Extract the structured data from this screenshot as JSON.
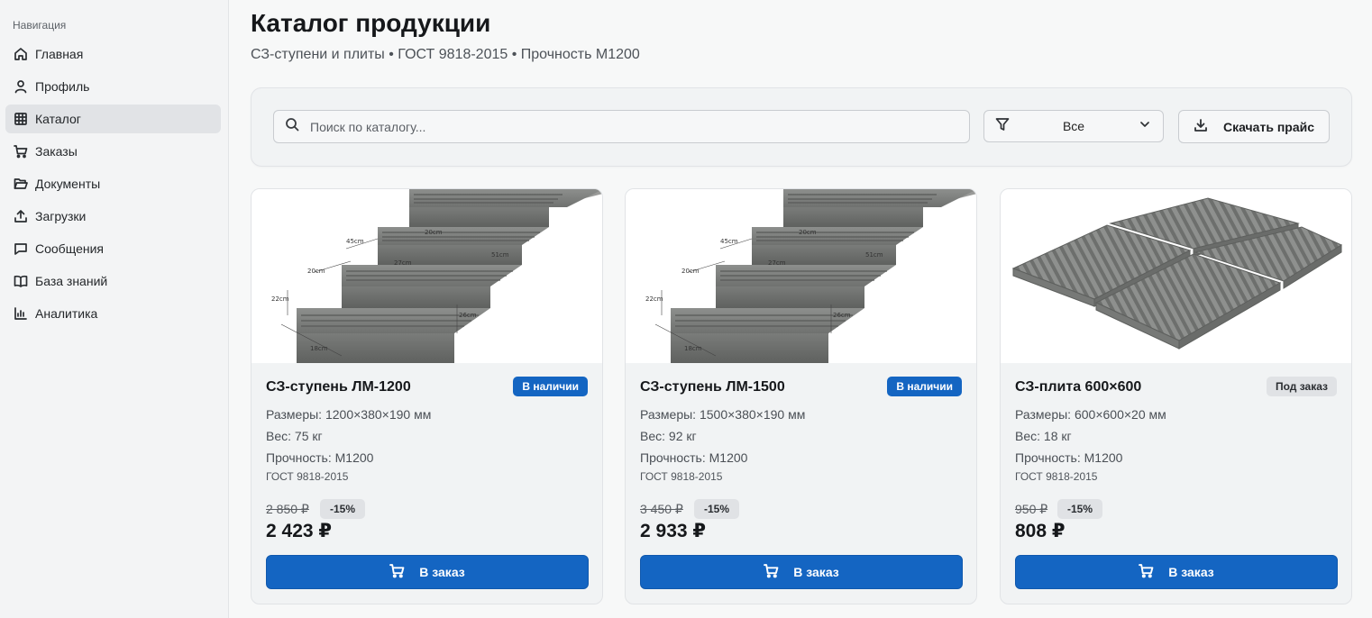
{
  "sidebar": {
    "heading": "Навигация",
    "items": [
      {
        "label": "Главная",
        "icon": "home-icon"
      },
      {
        "label": "Профиль",
        "icon": "user-icon"
      },
      {
        "label": "Каталог",
        "icon": "grid-icon",
        "active": true
      },
      {
        "label": "Заказы",
        "icon": "cart-icon"
      },
      {
        "label": "Документы",
        "icon": "folder-icon"
      },
      {
        "label": "Загрузки",
        "icon": "upload-icon"
      },
      {
        "label": "Сообщения",
        "icon": "message-icon"
      },
      {
        "label": "База знаний",
        "icon": "book-icon"
      },
      {
        "label": "Аналитика",
        "icon": "chart-icon"
      }
    ]
  },
  "header": {
    "title": "Каталог продукции",
    "subtitle": "СЗ-ступени и плиты • ГОСТ 9818-2015 • Прочность М1200"
  },
  "toolbar": {
    "search_placeholder": "Поиск по каталогу...",
    "filter_value": "Все",
    "download_label": "Скачать прайс"
  },
  "colors": {
    "accent": "#1465c2",
    "badge_neutral": "#e0e2e5"
  },
  "products": [
    {
      "name": "СЗ-ступень ЛМ-1200",
      "badge": "В наличии",
      "size": "Размеры: 1200×380×190 мм",
      "weight": "Вес: 75 кг",
      "strength": "Прочность: М1200",
      "gost": "ГОСТ 9818-2015",
      "old_price": "2 850 ₽",
      "discount": "-15%",
      "price": "2 423 ₽",
      "button": "В заказ",
      "image_labels": [
        "45cm",
        "20cm",
        "27cm",
        "20cm",
        "51cm",
        "22cm",
        "26cm",
        "18cm"
      ]
    },
    {
      "name": "СЗ-ступень ЛМ-1500",
      "badge": "В наличии",
      "size": "Размеры: 1500×380×190 мм",
      "weight": "Вес: 92 кг",
      "strength": "Прочность: М1200",
      "gost": "ГОСТ 9818-2015",
      "old_price": "3 450 ₽",
      "discount": "-15%",
      "price": "2 933 ₽",
      "button": "В заказ",
      "image_labels": [
        "45cm",
        "20cm",
        "27cm",
        "20cm",
        "51cm",
        "22cm",
        "26cm",
        "18cm"
      ]
    },
    {
      "name": "СЗ-плита 600×600",
      "badge": "Под заказ",
      "size": "Размеры: 600×600×20 мм",
      "weight": "Вес: 18 кг",
      "strength": "Прочность: М1200",
      "gost": "ГОСТ 9818-2015",
      "old_price": "950 ₽",
      "discount": "-15%",
      "price": "808 ₽",
      "button": "В заказ"
    }
  ]
}
